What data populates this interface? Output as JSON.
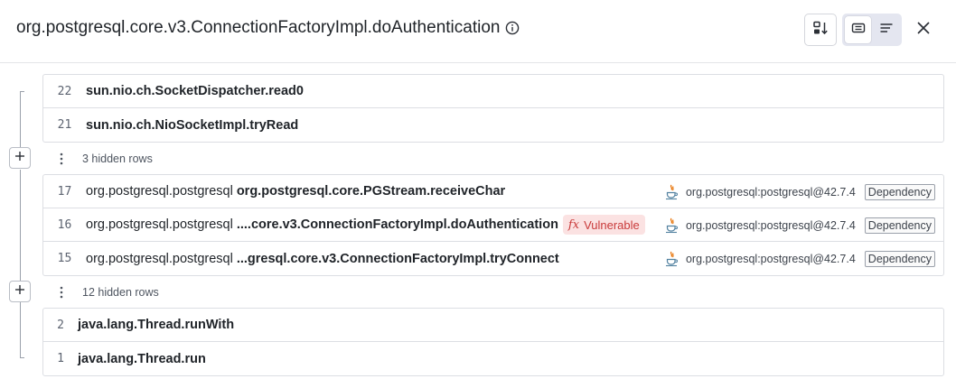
{
  "header": {
    "title": "org.postgresql.core.v3.ConnectionFactoryImpl.doAuthentication"
  },
  "groups": [
    {
      "rows": [
        {
          "line": "22",
          "function": "sun.nio.ch.SocketDispatcher.read0"
        },
        {
          "line": "21",
          "function": "sun.nio.ch.NioSocketImpl.tryRead"
        }
      ]
    },
    {
      "rows": [
        {
          "line": "17",
          "package": "org.postgresql.postgresql",
          "function": "org.postgresql.core.PGStream.receiveChar",
          "dependency": "org.postgresql:postgresql@42.7.4",
          "badge": "Dependency"
        },
        {
          "line": "16",
          "package": "org.postgresql.postgresql",
          "function": "....core.v3.ConnectionFactoryImpl.doAuthentication",
          "vulnerable_label": "Vulnerable",
          "dependency": "org.postgresql:postgresql@42.7.4",
          "badge": "Dependency"
        },
        {
          "line": "15",
          "package": "org.postgresql.postgresql",
          "function": "...gresql.core.v3.ConnectionFactoryImpl.tryConnect",
          "dependency": "org.postgresql:postgresql@42.7.4",
          "badge": "Dependency"
        }
      ]
    },
    {
      "rows": [
        {
          "line": "2",
          "function": "java.lang.Thread.runWith"
        },
        {
          "line": "1",
          "function": "java.lang.Thread.run"
        }
      ]
    }
  ],
  "hidden": [
    {
      "label": "3 hidden rows"
    },
    {
      "label": "12 hidden rows"
    }
  ],
  "icons": {
    "info": "info-icon",
    "sort": "sort-icon",
    "view_compact": "compact-view-icon",
    "view_list": "list-view-icon",
    "close": "close-icon",
    "expand": "plus-icon",
    "more": "kebab-icon",
    "language": "java-icon"
  },
  "colors": {
    "vulnerable_bg": "#fbe2e2",
    "vulnerable_text": "#c93a3a",
    "border": "#dcdee3"
  }
}
